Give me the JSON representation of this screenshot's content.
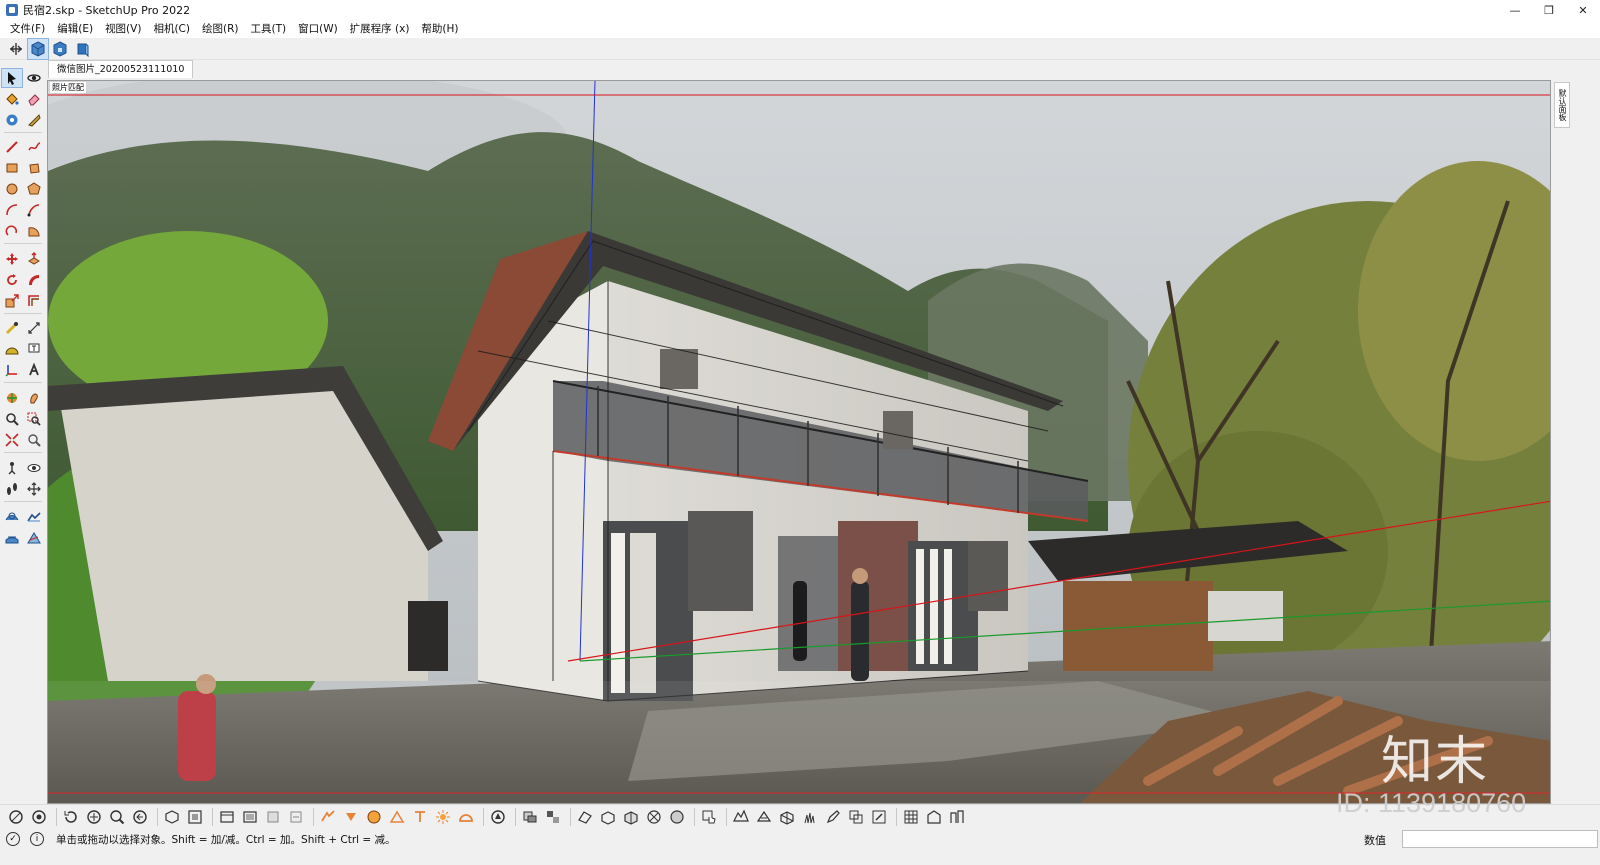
{
  "window": {
    "title": "民宿2.skp - SketchUp Pro 2022",
    "minimize": "—",
    "restore": "❐",
    "close": "✕"
  },
  "menu": [
    "文件(F)",
    "编辑(E)",
    "视图(V)",
    "相机(C)",
    "绘图(R)",
    "工具(T)",
    "窗口(W)",
    "扩展程序 (x)",
    "帮助(H)"
  ],
  "scene_tab": "微信图片_20200523111010",
  "viewport": {
    "photo_label": "照片匹配"
  },
  "right_tray": {
    "tab": "默认面板"
  },
  "watermark": {
    "logo": "知末",
    "id": "ID: 1139180760"
  },
  "status": {
    "hint": "单击或拖动以选择对象。Shift = 加/减。Ctrl = 加。Shift + Ctrl = 减。",
    "measurements_label": "数值",
    "measurements_value": ""
  },
  "colors": {
    "accent": "#3b6fb6",
    "axis_red": "#d8141a",
    "axis_green": "#1a9a2a",
    "axis_blue": "#2233cc"
  }
}
